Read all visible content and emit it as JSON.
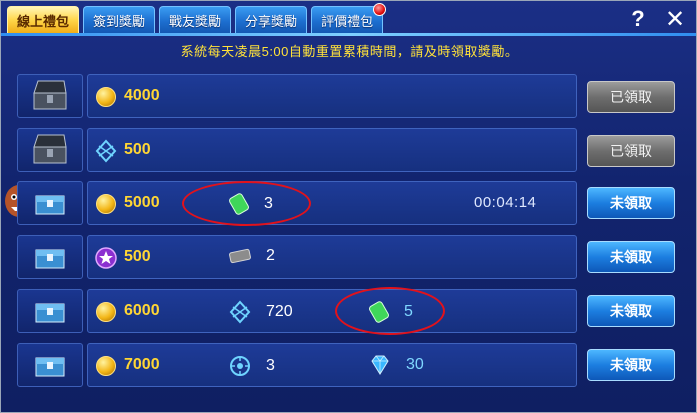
{
  "tabs": [
    {
      "label": "線上禮包",
      "active": true
    },
    {
      "label": "簽到獎勵",
      "active": false
    },
    {
      "label": "戰友獎勵",
      "active": false
    },
    {
      "label": "分享獎勵",
      "active": false
    },
    {
      "label": "評價禮包",
      "active": false,
      "badge": true
    }
  ],
  "header": {
    "help_label": "?",
    "close_label": "✕"
  },
  "notice": "系統每天凌晨5:00自動重置累積時間，請及時領取獎勵。",
  "rows": [
    {
      "chest": "chest-open-icon",
      "coin": "coin-icon",
      "points": "4000",
      "items": [],
      "timer": "",
      "button": "已領取",
      "claimed": true
    },
    {
      "chest": "chest-open-icon",
      "coin": "crystal-icon",
      "points": "500",
      "items": [],
      "timer": "",
      "button": "已領取",
      "claimed": true
    },
    {
      "chest": "chest-closed-icon",
      "coin": "coin-icon",
      "points": "5000",
      "items": [
        {
          "icon": "battery-icon",
          "value": "3"
        }
      ],
      "timer": "00:04:14",
      "button": "未領取",
      "claimed": false
    },
    {
      "chest": "chest-closed-icon",
      "coin": "star-badge-icon",
      "points": "500",
      "items": [
        {
          "icon": "ticket-icon",
          "value": "2"
        }
      ],
      "timer": "",
      "button": "未領取",
      "claimed": false
    },
    {
      "chest": "chest-closed-icon",
      "coin": "coin-icon",
      "points": "6000",
      "items": [
        {
          "icon": "crystal-icon",
          "value": "720"
        },
        {
          "icon": "battery-icon",
          "value": "5"
        }
      ],
      "timer": "",
      "button": "未領取",
      "claimed": false
    },
    {
      "chest": "chest-closed-icon",
      "coin": "coin-icon",
      "points": "7000",
      "items": [
        {
          "icon": "compass-icon",
          "value": "3"
        },
        {
          "icon": "diamond-icon",
          "value": "30",
          "blue": true
        }
      ],
      "timer": "",
      "button": "未領取",
      "claimed": false
    }
  ],
  "colors": {
    "highlight": "#ffd634",
    "annotation": "#e2121b",
    "claim_open": "#1c7ee0",
    "claim_done": "#6e6e6e"
  }
}
